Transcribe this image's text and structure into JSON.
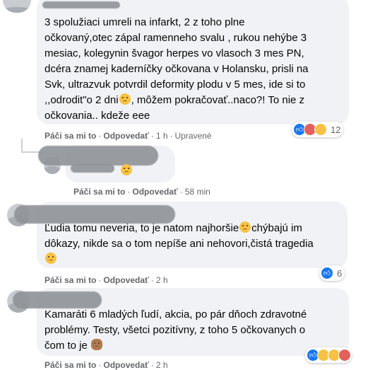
{
  "comments": [
    {
      "lines": [
        "3 spolužiaci umreli na infarkt, 2 z toho plne",
        "očkovaný,otec zápal ramenneho svalu , rukou nehýbe 3",
        "mesiac, kolegynin švagor herpes vo vlasoch 3 mes PN,",
        "dcéra znamej kaderníčky očkovana v Holansku, prisli na",
        "Svk, ultrazvuk potvrdil deformity plodu v 5 mes, ide si to",
        ",,odrodit\"o 2 dni",
        ", môžem pokračovať..naco?! To nie z",
        "očkovania.. kdeže eee"
      ],
      "like": "Páči sa mi to",
      "reply": "Odpovedať",
      "time": "1 h",
      "edited": "Upravené",
      "reaction_count": "12"
    },
    {
      "like": "Páči sa mi to",
      "reply": "Odpovedať",
      "time": "58 min"
    },
    {
      "lines": [
        "Ľudia tomu neveria, to je natom najhoršie",
        "chýbajú im",
        "dôkazy, nikde sa o tom nepíše ani nehovori,čistá tragedia"
      ],
      "like": "Páči sa mi to",
      "reply": "Odpovedať",
      "time": "2 h",
      "reaction_count": "6"
    },
    {
      "lines": [
        "Kamaráti 6 mladých ľudí, akcia, po pár dňoch zdravotné",
        "problémy. Testy, všetci pozitívny, z toho 5 očkovanych o",
        "čom to je"
      ],
      "like": "Páči sa mi to",
      "reply": "Odpovedať",
      "time": "2 h"
    }
  ],
  "separator": "·",
  "icons": {
    "like": "like-reaction-icon",
    "angry": "angry-reaction-icon",
    "wow": "wow-reaction-icon",
    "sad": "sad-reaction-icon"
  },
  "colors": {
    "bubble": "#f0f2f5",
    "meta": "#65676b",
    "like": "#1877f2"
  }
}
